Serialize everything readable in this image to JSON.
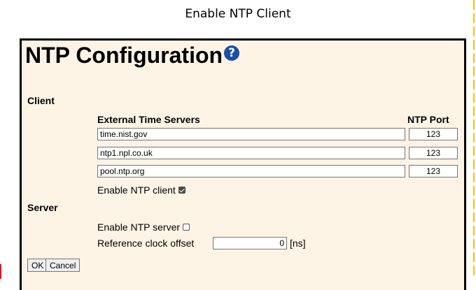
{
  "caption": "Enable NTP Client",
  "title": "NTP Configuration",
  "help_icon": "question-circle-icon",
  "client": {
    "section_label": "Client",
    "servers_header": "External Time Servers",
    "port_header": "NTP Port",
    "servers": [
      {
        "host": "time.nist.gov",
        "port": "123"
      },
      {
        "host": "ntp1.npl.co.uk",
        "port": "123"
      },
      {
        "host": "pool.ntp.org",
        "port": "123"
      }
    ],
    "enable_label": "Enable NTP client",
    "enabled": true
  },
  "server": {
    "section_label": "Server",
    "enable_label": "Enable NTP server",
    "enabled": false,
    "offset_label": "Reference clock offset",
    "offset_value": "0",
    "offset_unit": "[ns]"
  },
  "buttons": {
    "ok": "OK",
    "cancel": "Cancel"
  },
  "colors": {
    "panel_bg": "#fdf4e6",
    "help_icon": "#1b4fa5",
    "edge_accent": "#f5c400"
  }
}
